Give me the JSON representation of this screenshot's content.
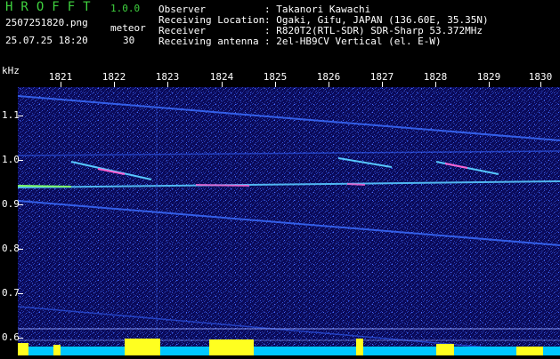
{
  "header": {
    "logo": "HROFFT",
    "version": "1.0.0",
    "filename": "2507251820.png",
    "datetime": "25.07.25 18:20",
    "count_label": "meteor",
    "count_value": "30",
    "fields": [
      {
        "label": "Observer",
        "value": ": Takanori Kawachi"
      },
      {
        "label": "Receiving Location",
        "value": ": Ogaki, Gifu, JAPAN (136.60E, 35.35N)"
      },
      {
        "label": "Receiver",
        "value": ": R820T2(RTL-SDR) SDR-Sharp 53.372MHz"
      },
      {
        "label": "Receiving antenna",
        "value": ": 2el-HB9CV Vertical (el. E-W)"
      }
    ]
  },
  "axis": {
    "y_unit": "kHz",
    "x_ticks": [
      "1821",
      "1822",
      "1823",
      "1824",
      "1825",
      "1826",
      "1827",
      "1828",
      "1829",
      "1830"
    ],
    "y_ticks": [
      "1.1",
      "1.0",
      "0.9",
      "0.8",
      "0.7",
      "0.6"
    ]
  },
  "colors": {
    "background": "#0a0a5a",
    "noise": "#2a3fb0",
    "signal": "#57c8ff",
    "hot": "#ff5fd0",
    "bars": "#ffff20",
    "bar_base": "#00c8ff",
    "logo": "#3fd23f"
  }
}
